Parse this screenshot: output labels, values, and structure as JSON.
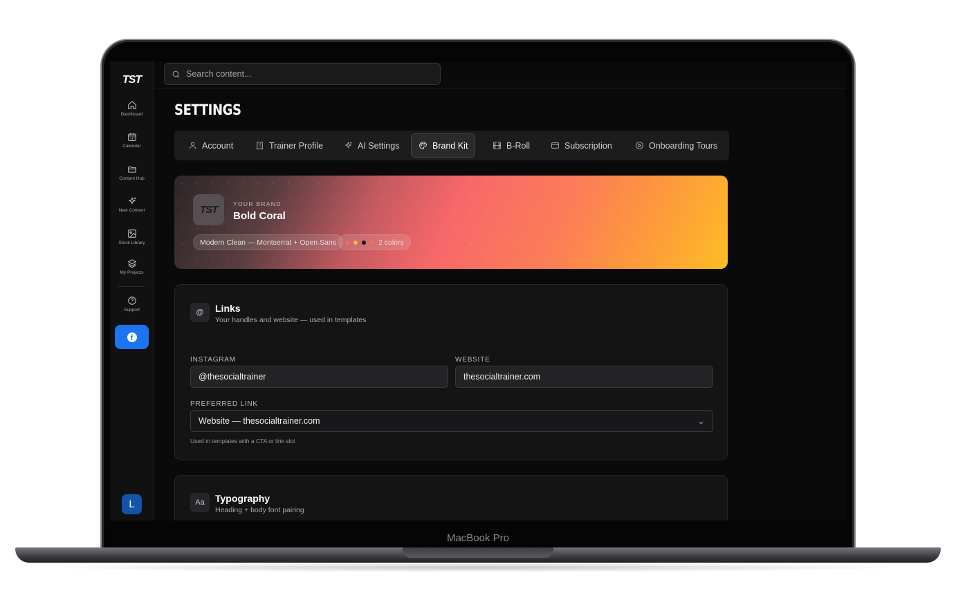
{
  "device": {
    "label": "MacBook Pro"
  },
  "sidebar": {
    "logo": "TST",
    "items": [
      {
        "label": "Dashboard",
        "icon": "home-icon"
      },
      {
        "label": "Calendar",
        "icon": "calendar-icon"
      },
      {
        "label": "Content Hub",
        "icon": "folder-icon"
      },
      {
        "label": "New Content",
        "icon": "sparkles-icon"
      },
      {
        "label": "Stock Library",
        "icon": "image-icon"
      },
      {
        "label": "My Projects",
        "icon": "layers-icon"
      },
      {
        "label": "Support",
        "icon": "help-icon"
      }
    ],
    "social_button_icon": "facebook-icon",
    "avatar_initial": "L"
  },
  "search": {
    "placeholder": "Search content..."
  },
  "page": {
    "title": "SETTINGS"
  },
  "tabs": [
    {
      "label": "Account",
      "icon": "user-icon"
    },
    {
      "label": "Trainer Profile",
      "icon": "building-icon"
    },
    {
      "label": "AI Settings",
      "icon": "sparkles-icon"
    },
    {
      "label": "Brand Kit",
      "icon": "palette-icon",
      "active": true
    },
    {
      "label": "B-Roll",
      "icon": "film-icon"
    },
    {
      "label": "Subscription",
      "icon": "credit-card-icon"
    },
    {
      "label": "Onboarding Tours",
      "icon": "play-circle-icon"
    }
  ],
  "brand": {
    "logo": "TST",
    "eyebrow": "YOUR BRAND",
    "name": "Bold Coral",
    "font_chip": "Modern Clean — Montserrat + Open Sans",
    "colors_chip": "2 colors",
    "swatches": [
      "#f86a6a",
      "#fbb82b",
      "#111111",
      "#f26f5b"
    ]
  },
  "links_panel": {
    "icon_glyph": "@",
    "title": "Links",
    "subtitle": "Your handles and website — used in templates",
    "instagram_label": "INSTAGRAM",
    "instagram_value": "@thesocialtrainer",
    "website_label": "WEBSITE",
    "website_value": "thesocialtrainer.com",
    "preferred_label": "PREFERRED LINK",
    "preferred_value": "Website — thesocialtrainer.com",
    "preferred_hint": "Used in templates with a CTA or link slot"
  },
  "typography_panel": {
    "icon_glyph": "Aa",
    "title": "Typography",
    "subtitle": "Heading + body font pairing"
  }
}
